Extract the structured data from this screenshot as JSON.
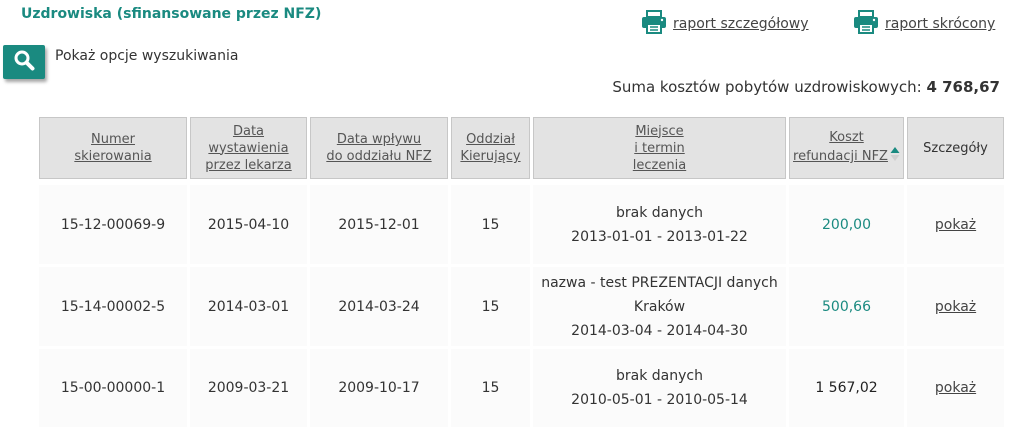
{
  "header": {
    "title": "Uzdrowiska (sfinansowane przez NFZ)",
    "report_detailed": "raport szczegółowy",
    "report_short": "raport skrócony"
  },
  "search": {
    "toggle_label": "Pokaż opcje wyszukiwania"
  },
  "summary": {
    "label": "Suma kosztów pobytów uzdrowiskowych:",
    "value": "4 768,67"
  },
  "colors": {
    "accent": "#1a8a80",
    "header_bg": "#e3e3e3",
    "row_bg": "#fbfbfb"
  },
  "table": {
    "columns": [
      [
        "Numer",
        "skierowania"
      ],
      [
        "Data",
        "wystawienia",
        "przez lekarza"
      ],
      [
        "Data wpływu",
        "do oddziału NFZ"
      ],
      [
        "Oddział",
        "Kierujący"
      ],
      [
        "Miejsce",
        "i termin",
        "leczenia"
      ],
      [
        "Koszt",
        "refundacji NFZ"
      ],
      [
        "Szczegóły"
      ]
    ],
    "sort_column_index": 5,
    "sort_direction": "ascending",
    "rows": [
      {
        "number": "15-12-00069-9",
        "issue_date": "2015-04-10",
        "receipt_date": "2015-12-01",
        "branch": "15",
        "place_lines": [
          "brak danych",
          "2013-01-01 - 2013-01-22"
        ],
        "cost": "200,00",
        "details": "pokaż"
      },
      {
        "number": "15-14-00002-5",
        "issue_date": "2014-03-01",
        "receipt_date": "2014-03-24",
        "branch": "15",
        "place_lines": [
          "nazwa - test PREZENTACJI danych",
          "Kraków",
          "2014-03-04 - 2014-04-30"
        ],
        "cost": "500,66",
        "details": "pokaż"
      },
      {
        "number": "15-00-00000-1",
        "issue_date": "2009-03-21",
        "receipt_date": "2009-10-17",
        "branch": "15",
        "place_lines": [
          "brak danych",
          "2010-05-01 - 2010-05-14"
        ],
        "cost": "1 567,02",
        "details": "pokaż"
      }
    ]
  }
}
